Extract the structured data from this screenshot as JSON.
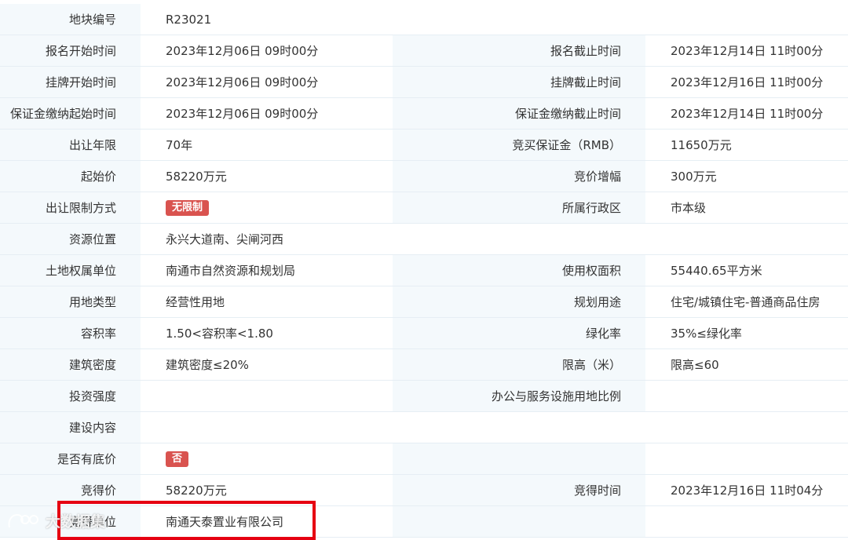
{
  "rows": [
    {
      "l1": "地块编号",
      "v1": "R23021",
      "l2": "",
      "v2": ""
    },
    {
      "l1": "报名开始时间",
      "v1": "2023年12月06日 09时00分",
      "l2": "报名截止时间",
      "v2": "2023年12月14日 11时00分"
    },
    {
      "l1": "挂牌开始时间",
      "v1": "2023年12月06日 09时00分",
      "l2": "挂牌截止时间",
      "v2": "2023年12月16日 11时00分"
    },
    {
      "l1": "保证金缴纳起始时间",
      "v1": "2023年12月06日 09时00分",
      "l2": "保证金缴纳截止时间",
      "v2": "2023年12月14日 11时00分"
    },
    {
      "l1": "出让年限",
      "v1": "70年",
      "l2": "竞买保证金（RMB）",
      "v2": "11650万元"
    },
    {
      "l1": "起始价",
      "v1": "58220万元",
      "l2": "竞价增幅",
      "v2": "300万元"
    },
    {
      "l1": "出让限制方式",
      "v1": "无限制",
      "l2": "所属行政区",
      "v2": "市本级"
    },
    {
      "l1": "资源位置",
      "v1": "永兴大道南、尖闸河西",
      "l2": "",
      "v2": ""
    },
    {
      "l1": "土地权属单位",
      "v1": "南通市自然资源和规划局",
      "l2": "使用权面积",
      "v2": "55440.65平方米"
    },
    {
      "l1": "用地类型",
      "v1": "经营性用地",
      "l2": "规划用途",
      "v2": "住宅/城镇住宅-普通商品住房"
    },
    {
      "l1": "容积率",
      "v1": "1.50<容积率<1.80",
      "l2": "绿化率",
      "v2": "35%≤绿化率"
    },
    {
      "l1": "建筑密度",
      "v1": "建筑密度≤20%",
      "l2": "限高（米）",
      "v2": "限高≤60"
    },
    {
      "l1": "投资强度",
      "v1": "",
      "l2": "办公与服务设施用地比例",
      "v2": ""
    },
    {
      "l1": "建设内容",
      "v1": "",
      "l2": "",
      "v2": ""
    },
    {
      "l1": "是否有底价",
      "v1": "否",
      "l2": "",
      "v2": ""
    },
    {
      "l1": "竞得价",
      "v1": "58220万元",
      "l2": "竞得时间",
      "v2": "2023年12月16日 11时04分"
    },
    {
      "l1": "竞得单位",
      "v1": "南通天泰置业有限公司",
      "l2": "",
      "v2": ""
    }
  ],
  "watermark": {
    "text": "大数据集"
  },
  "colors": {
    "label_bg": "#f4f9fc",
    "tag_bg": "#d9534f",
    "highlight_border": "#e60012"
  }
}
